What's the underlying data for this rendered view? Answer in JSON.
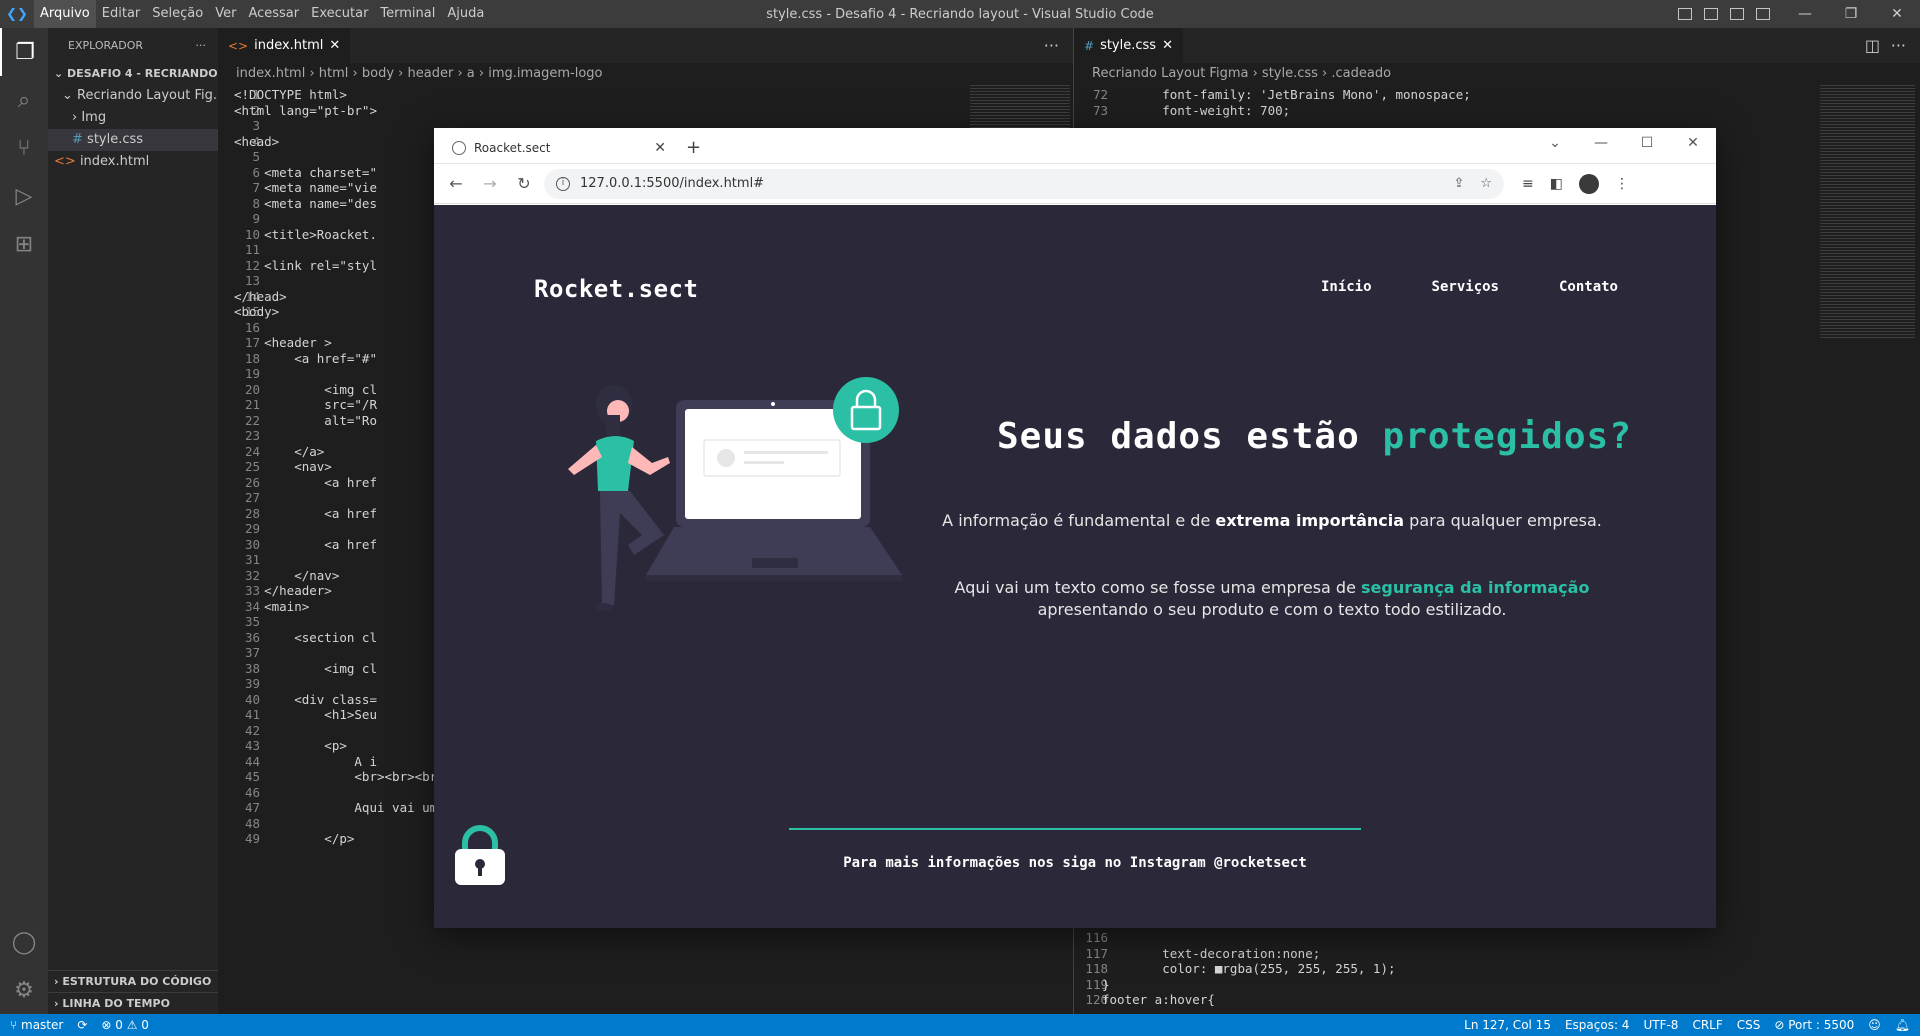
{
  "titlebar": {
    "menu": [
      "Arquivo",
      "Editar",
      "Seleção",
      "Ver",
      "Acessar",
      "Executar",
      "Terminal",
      "Ajuda"
    ],
    "title": "style.css - Desafio 4 - Recriando layout - Visual Studio Code"
  },
  "sidebar": {
    "header": "EXPLORADOR",
    "more": "···",
    "root": "DESAFIO 4 - RECRIANDO L...",
    "folder": "Recriando Layout Fig...",
    "subfolder": "Img",
    "file_css": "style.css",
    "file_html": "index.html",
    "outline": "ESTRUTURA DO CÓDIGO",
    "timeline": "LINHA DO TEMPO"
  },
  "editor_left": {
    "tab": "index.html",
    "breadcrumb": [
      "index.html",
      "html",
      "body",
      "header",
      "a",
      "img.imagem-logo"
    ],
    "line_numbers": [
      "1",
      "2",
      "3",
      "4",
      "5",
      "6",
      "7",
      "8",
      "9",
      "10",
      "11",
      "12",
      "13",
      "14",
      "15",
      "16",
      "17",
      "18",
      "19",
      "20",
      "21",
      "22",
      "23",
      "24",
      "25",
      "26",
      "27",
      "28",
      "29",
      "30",
      "31",
      "32",
      "33",
      "34",
      "35",
      "36",
      "37",
      "38",
      "39",
      "40",
      "41",
      "42",
      "43",
      "44",
      "45",
      "46",
      "47",
      "48",
      "49"
    ],
    "lines": [
      "<!DOCTYPE html>",
      "<html lang=\"pt-br\">",
      "",
      "<head>",
      "",
      "    <meta charset=\"",
      "    <meta name=\"vie",
      "    <meta name=\"des",
      "",
      "    <title>Roacket.",
      "",
      "    <link rel=\"styl",
      "",
      "</head>",
      "<body>",
      "",
      "    <header >",
      "        <a href=\"#\"",
      "",
      "            <img cl",
      "            src=\"/R",
      "            alt=\"Ro",
      "",
      "        </a>",
      "        <nav>",
      "            <a href",
      "",
      "            <a href",
      "",
      "            <a href",
      "",
      "        </nav>",
      "    </header>",
      "    <main>",
      "",
      "        <section cl",
      "",
      "            <img cl",
      "",
      "        <div class=",
      "            <h1>Seu",
      "",
      "            <p>",
      "                A i",
      "                <br><br><br>",
      "",
      "                Aqui vai um texto como se fosse uma empresa de <span>segurança da infor",
      "",
      "            </p>"
    ]
  },
  "editor_right": {
    "tab": "style.css",
    "breadcrumb": [
      "Recriando Layout Figma",
      "style.css",
      ".cadeado"
    ],
    "top_lines": [
      {
        "n": "72",
        "t": "        font-family: 'JetBrains Mono', monospace;"
      },
      {
        "n": "73",
        "t": "        font-weight: 700;"
      }
    ],
    "bottom_lines": [
      {
        "n": "116",
        "t": ""
      },
      {
        "n": "117",
        "t": "        text-decoration:none;"
      },
      {
        "n": "118",
        "t": "        color: ■rgba(255, 255, 255, 1);"
      },
      {
        "n": "119",
        "t": "}"
      },
      {
        "n": "120",
        "t": "footer a:hover{"
      }
    ]
  },
  "browser": {
    "tab_title": "Roacket.sect",
    "url": "127.0.0.1:5500/index.html#",
    "page": {
      "logo": "Rocket.sect",
      "nav": [
        "Início",
        "Serviços",
        "Contato"
      ],
      "heading_main": "Seus dados estão ",
      "heading_highlight": "protegidos?",
      "p1_start": "A informação é fundamental e de ",
      "p1_bold": "extrema importância",
      "p1_end": " para qualquer empresa.",
      "p2_start": "Aqui vai um texto como se fosse uma empresa de ",
      "p2_highlight": "segurança da informação",
      "p2_end": "apresentando o seu produto e com o texto todo estilizado.",
      "footer": "Para mais informações nos siga no Instagram @rocketsect"
    }
  },
  "status": {
    "branch": "master",
    "sync": "⟳",
    "errors": "⊗ 0 ⚠ 0",
    "position": "Ln 127, Col 15",
    "spaces": "Espaços: 4",
    "encoding": "UTF-8",
    "eol": "CRLF",
    "language": "CSS",
    "port": "⊘ Port : 5500"
  },
  "colors": {
    "accent": "#2bc0a5",
    "page_bg": "#2a2839",
    "statusbar": "#007acc"
  }
}
